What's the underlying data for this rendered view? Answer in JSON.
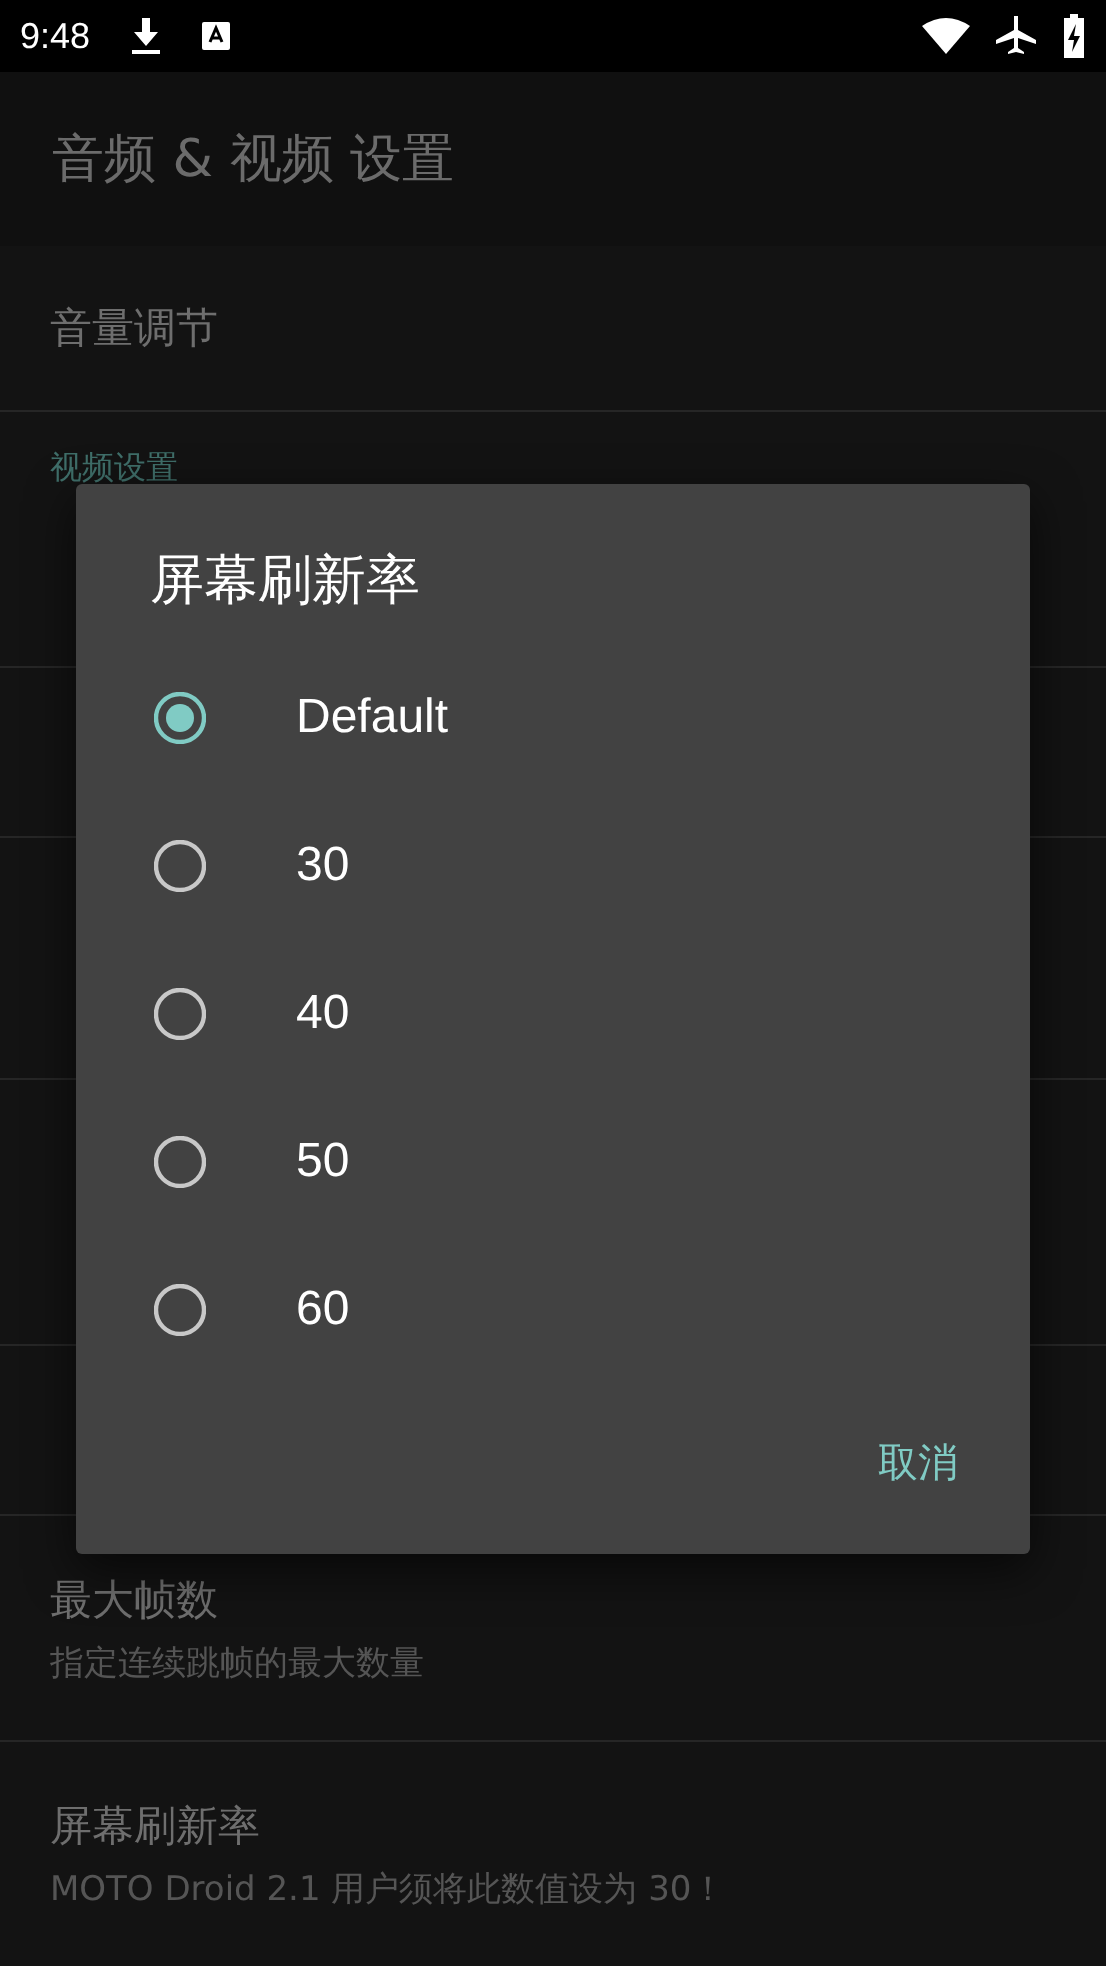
{
  "status_bar": {
    "time": "9:48"
  },
  "app_bar": {
    "title": "音频 & 视频 设置"
  },
  "settings": [
    {
      "kind": "item",
      "title": "音量调节"
    },
    {
      "kind": "category",
      "title": "视频设置"
    },
    {
      "kind": "hidden"
    },
    {
      "kind": "hidden"
    },
    {
      "kind": "hidden"
    },
    {
      "kind": "hidden"
    },
    {
      "kind": "hidden"
    },
    {
      "kind": "item",
      "title": "最大帧数",
      "summary": "指定连续跳帧的最大数量"
    },
    {
      "kind": "item",
      "title": "屏幕刷新率",
      "summary": "MOTO Droid 2.1 用户须将此数值设为 30！"
    }
  ],
  "dialog": {
    "title": "屏幕刷新率",
    "options": [
      {
        "label": "Default",
        "selected": true
      },
      {
        "label": "30",
        "selected": false
      },
      {
        "label": "40",
        "selected": false
      },
      {
        "label": "50",
        "selected": false
      },
      {
        "label": "60",
        "selected": false
      }
    ],
    "buttons": [
      "取消"
    ]
  }
}
